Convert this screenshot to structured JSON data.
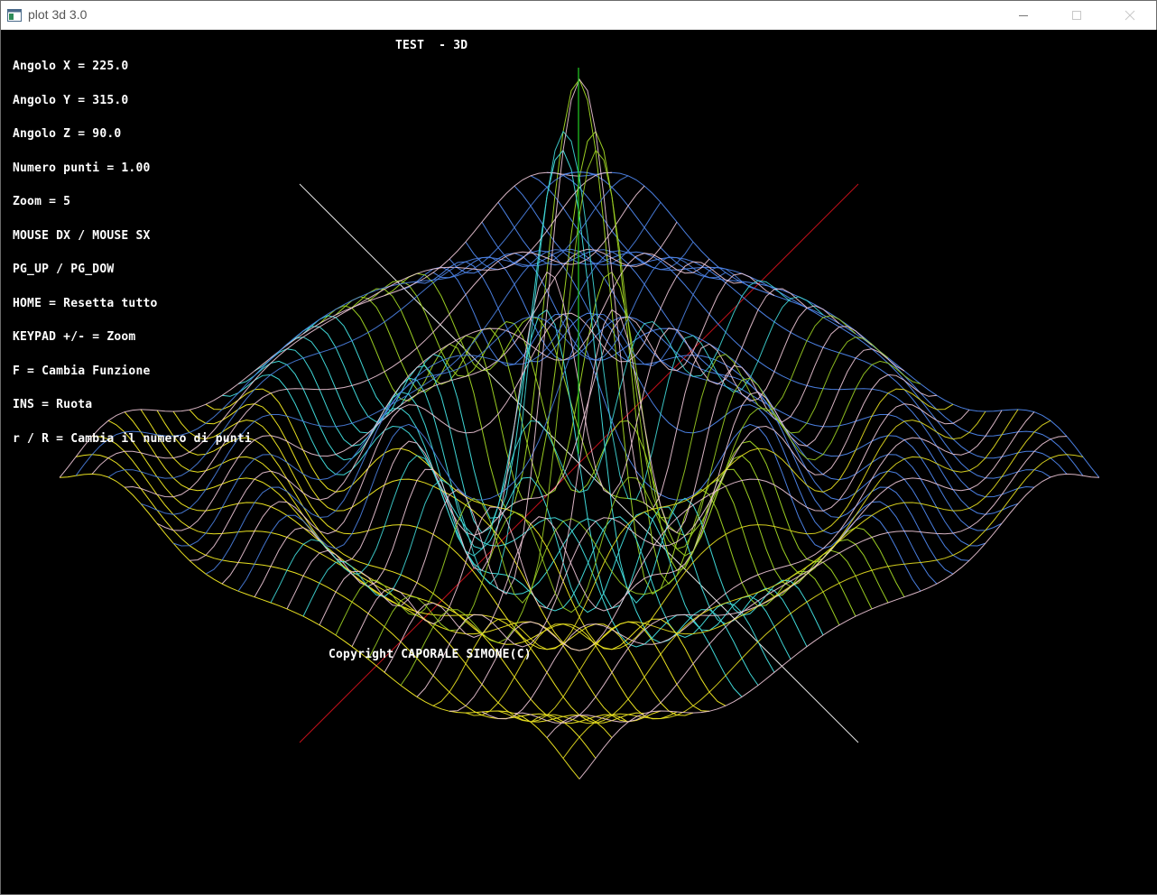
{
  "window": {
    "title": "plot 3d 3.0",
    "icons": {
      "app": "app-window-icon",
      "minimize": "minimize-icon",
      "maximize": "maximize-icon",
      "close": "close-icon"
    }
  },
  "plot": {
    "title": "TEST  - 3D",
    "help_lines": [
      "Angolo X = 225.0",
      "Angolo Y = 315.0",
      "Angolo Z = 90.0",
      "Numero punti = 1.00",
      "Zoom = 5",
      "MOUSE DX / MOUSE SX",
      "PG_UP / PG_DOW",
      "HOME = Resetta tutto",
      "KEYPAD +/- = Zoom",
      "F = Cambia Funzione",
      "INS = Ruota",
      "r / R = Cambia il numero di punti"
    ],
    "copyright": "Copyright CAPORALE SIMONE(C)",
    "colors": {
      "background": "#000000",
      "text": "#ffffff",
      "axis_red": "#c0101a",
      "axis_white": "#e6e6e6",
      "axis_green": "#22cc22",
      "mesh_blue": "#4a7fe0",
      "mesh_cyan": "#3fd6d6",
      "mesh_yellow": "#e8e020",
      "mesh_green": "#9acd22",
      "mesh_pink": "#f0c8d8"
    }
  }
}
